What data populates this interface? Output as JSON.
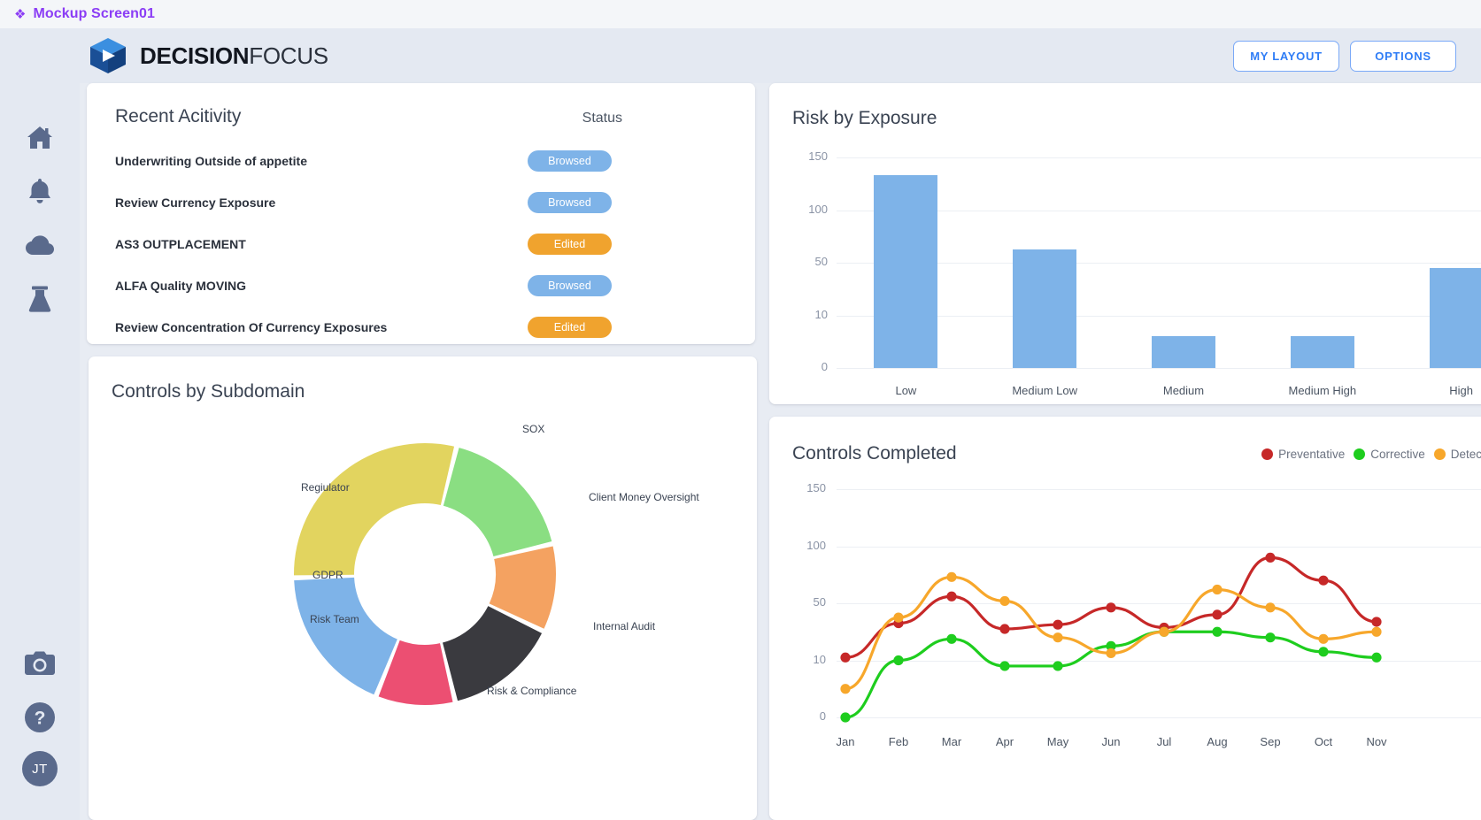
{
  "mockup": {
    "label": "Mockup Screen01",
    "icon": "diamond-icon",
    "accent": "#8b3df5"
  },
  "header": {
    "brand_bold": "DECISION",
    "brand_light": "FOCUS",
    "buttons": [
      {
        "name": "my-layout-button",
        "label": "MY LAYOUT"
      },
      {
        "name": "options-button",
        "label": "OPTIONS"
      }
    ],
    "button_color": "#2f7df6"
  },
  "sidebar": {
    "items": [
      {
        "icon": "home-icon",
        "name": "sidebar-item-home"
      },
      {
        "icon": "bell-icon",
        "name": "sidebar-item-notifications"
      },
      {
        "icon": "cloud-icon",
        "name": "sidebar-item-cloud"
      },
      {
        "icon": "flask-icon",
        "name": "sidebar-item-lab"
      }
    ],
    "bottom_items": [
      {
        "icon": "camera-icon",
        "name": "sidebar-item-screenshot"
      },
      {
        "icon": "help-icon",
        "name": "sidebar-item-help"
      }
    ],
    "avatar": {
      "initials": "JT",
      "name": "user-avatar"
    },
    "icon_color": "#5a6a8c"
  },
  "activity": {
    "title": "Recent Acitivity",
    "status_header": "Status",
    "status_colors": {
      "browsed": "#7eb3e8",
      "edited": "#f0a32e"
    },
    "rows": [
      {
        "label": "Underwriting Outside of appetite",
        "status": "Browsed",
        "kind": "browsed"
      },
      {
        "label": "Review Currency Exposure",
        "status": "Browsed",
        "kind": "browsed"
      },
      {
        "label": "AS3 OUTPLACEMENT",
        "status": "Edited",
        "kind": "edited"
      },
      {
        "label": "ALFA Quality MOVING",
        "status": "Browsed",
        "kind": "browsed"
      },
      {
        "label": "Review Concentration Of Currency Exposures",
        "status": "Edited",
        "kind": "edited"
      }
    ]
  },
  "donut": {
    "title": "Controls by Subdomain"
  },
  "risk": {
    "title": "Risk by Exposure"
  },
  "lines": {
    "title": "Controls Completed",
    "legend": [
      {
        "label": "Preventative",
        "color": "#c62828"
      },
      {
        "label": "Corrective",
        "color": "#1ecd1e"
      },
      {
        "label": "Detective",
        "color": "#f7a72b"
      }
    ]
  },
  "chart_data": [
    {
      "type": "bar",
      "title": "Risk by Exposure",
      "categories": [
        "Low",
        "Medium Low",
        "Medium",
        "Medium High",
        "High"
      ],
      "values": [
        133,
        63,
        6,
        6,
        46
      ],
      "xlabel": "",
      "ylabel": "",
      "ytick_labels": [
        "0",
        "10",
        "50",
        "100",
        "150"
      ],
      "ytick_values": [
        0,
        10,
        50,
        100,
        150
      ],
      "ylim": [
        0,
        150
      ],
      "grid": true,
      "legend": "none",
      "bar_color": "#7eb3e8",
      "note": "y-axis ticks are unevenly-valued but evenly spaced on screen"
    },
    {
      "type": "pie",
      "subtype": "donut",
      "title": "Controls by Subdomain",
      "labels": [
        "SOX",
        "Client Money Oversight",
        "Internal Audit",
        "Risk & Compliance",
        "Risk Team",
        "GDPR",
        "Regiulator"
      ],
      "values": [
        16,
        10,
        13,
        9,
        17,
        0,
        27
      ],
      "colors": [
        "#8ade82",
        "#f4a261",
        "#3a3a3f",
        "#ec4f72",
        "#7eb3e8",
        "#e2d45f",
        "#e2d45f"
      ],
      "legend": "labels-around-chart",
      "note": "GDPR and Regiulator labels both point at the large yellow slice"
    },
    {
      "type": "line",
      "title": "Controls Completed",
      "x": [
        "Jan",
        "Feb",
        "Mar",
        "Apr",
        "May",
        "Jun",
        "Jul",
        "Aug",
        "Sep",
        "Oct",
        "Nov"
      ],
      "ytick_labels": [
        "0",
        "10",
        "50",
        "100",
        "150"
      ],
      "ytick_values": [
        0,
        10,
        50,
        100,
        150
      ],
      "ylim": [
        0,
        150
      ],
      "grid": true,
      "legend": "top-right",
      "series": [
        {
          "name": "Preventative",
          "color": "#c62828",
          "values": [
            12,
            36,
            56,
            32,
            35,
            47,
            33,
            42,
            90,
            70,
            37
          ]
        },
        {
          "name": "Corrective",
          "color": "#1ecd1e",
          "values": [
            0,
            10,
            25,
            9,
            9,
            20,
            30,
            30,
            26,
            16,
            12
          ]
        },
        {
          "name": "Detective",
          "color": "#f7a72b",
          "values": [
            5,
            40,
            73,
            52,
            26,
            15,
            30,
            62,
            47,
            25,
            30
          ]
        }
      ]
    }
  ]
}
